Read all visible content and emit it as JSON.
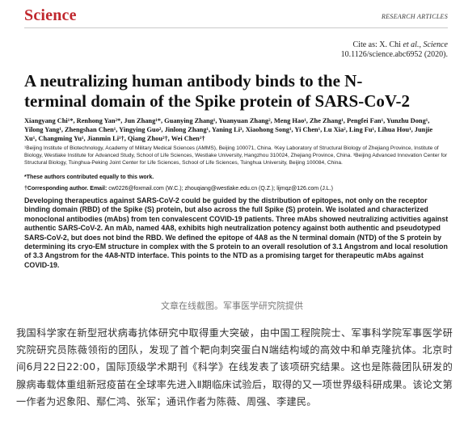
{
  "journal": {
    "logo": "Science",
    "section": "RESEARCH ARTICLES",
    "cite_prefix": "Cite as: X. Chi ",
    "cite_etal": "et al.",
    "cite_journal": ", Science",
    "cite_doi": "10.1126/science.abc6952 (2020)."
  },
  "article": {
    "title": "A neutralizing human antibody binds to the N-terminal domain of the Spike protein of SARS-CoV-2",
    "authors": "Xiangyang Chi¹*, Renhong Yan²*, Jun Zhang¹*, Guanying Zhang¹, Yuanyuan Zhang², Meng Hao¹, Zhe Zhang¹, Pengfei Fan¹, Yunzhu Dong¹, Yilong Yang¹, Zhengshan Chen¹, Yingying Guo², Jinlong Zhang¹, Yaning Li³, Xiaohong Song¹, Yi Chen¹, Lu Xia², Ling Fu¹, Lihua Hou¹, Junjie Xu¹, Changming Yu¹, Jianmin Li¹†, Qiang Zhou²†, Wei Chen¹†",
    "affiliations": "¹Beijing Institute of Biotechnology, Academy of Military Medical Sciences (AMMS), Beijing 100071, China. ²Key Laboratory of Structural Biology of Zhejiang Province, Institute of Biology, Westlake Institute for Advanced Study, School of Life Sciences, Westlake University, Hangzhou 310024, Zhejiang Province, China. ³Beijing Advanced Innovation Center for Structural Biology, Tsinghua-Peking Joint Center for Life Sciences, School of Life Sciences, Tsinghua University, Beijing 100084, China.",
    "equal_contribution": "*These authors contributed equally to this work.",
    "corresponding_label": "†Corresponding author. Email:",
    "corresponding_emails": " cw0226@foxmail.com (W.C.); zhouqiang@westlake.edu.cn (Q.Z.); lijmqz@126.com (J.L.)",
    "abstract": "Developing therapeutics against SARS-CoV-2 could be guided by the distribution of epitopes, not only on the receptor binding domain (RBD) of the Spike (S) protein, but also across the full Spike (S) protein. We isolated and characterized monoclonal antibodies (mAbs) from ten convalescent COVID-19 patients. Three mAbs showed neutralizing activities against authentic SARS-CoV-2. An mAb, named 4A8, exhibits high neutralization potency against both authentic and pseudotyped SARS-CoV-2, but does not bind the RBD. We defined the epitope of 4A8 as the N terminal domain (NTD) of the S protein by determining its cryo-EM structure in complex with the S protein to an overall resolution of 3.1 Angstrom and local resolution of 3.3 Angstrom for the 4A8-NTD interface. This points to the NTD as a promising target for therapeutic mAbs against COVID-19."
  },
  "caption": "文章在线截图。军事医学研究院提供",
  "body_text": "我国科学家在新型冠状病毒抗体研究中取得重大突破，由中国工程院院士、军事科学院军事医学研究院研究员陈薇领衔的团队，发现了首个靶向刺突蛋白N端结构域的高效中和单克隆抗体。北京时间6月22日22:00，国际顶级学术期刊《科学》在线发表了该项研究结果。这也是陈薇团队研发的腺病毒载体重组新冠疫苗在全球率先进入Ⅱ期临床试验后，取得的又一项世界级科研成果。该论文第一作者为迟象阳、鄢仁鸿、张军；通讯作者为陈薇、周强、李建民。"
}
